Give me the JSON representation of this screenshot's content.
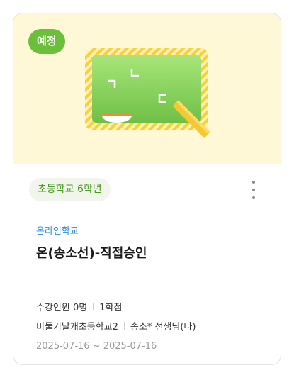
{
  "card": {
    "status_badge": "예정",
    "grade": "초등학교 6학년",
    "category": "온라인학교",
    "title": "온(송소선)-직접승인",
    "enrollment": "수강인원 0명",
    "credits": "1학점",
    "school": "비둘기날개초등학교2",
    "teacher": "송소* 선생님(나)",
    "dates": "2025-07-16 ~ 2025-07-16"
  },
  "colors": {
    "banner_bg": "#fff8d6",
    "badge_green": "#6cbf3b",
    "chalkboard_green": "#7fcf4f",
    "chalk_yellow": "#f7d13a",
    "category_blue": "#2a8cd6",
    "grade_chip_text": "#4c9a24"
  },
  "icons": {
    "banner_illustration": "chalkboard-icon",
    "menu": "more-vertical-icon"
  }
}
